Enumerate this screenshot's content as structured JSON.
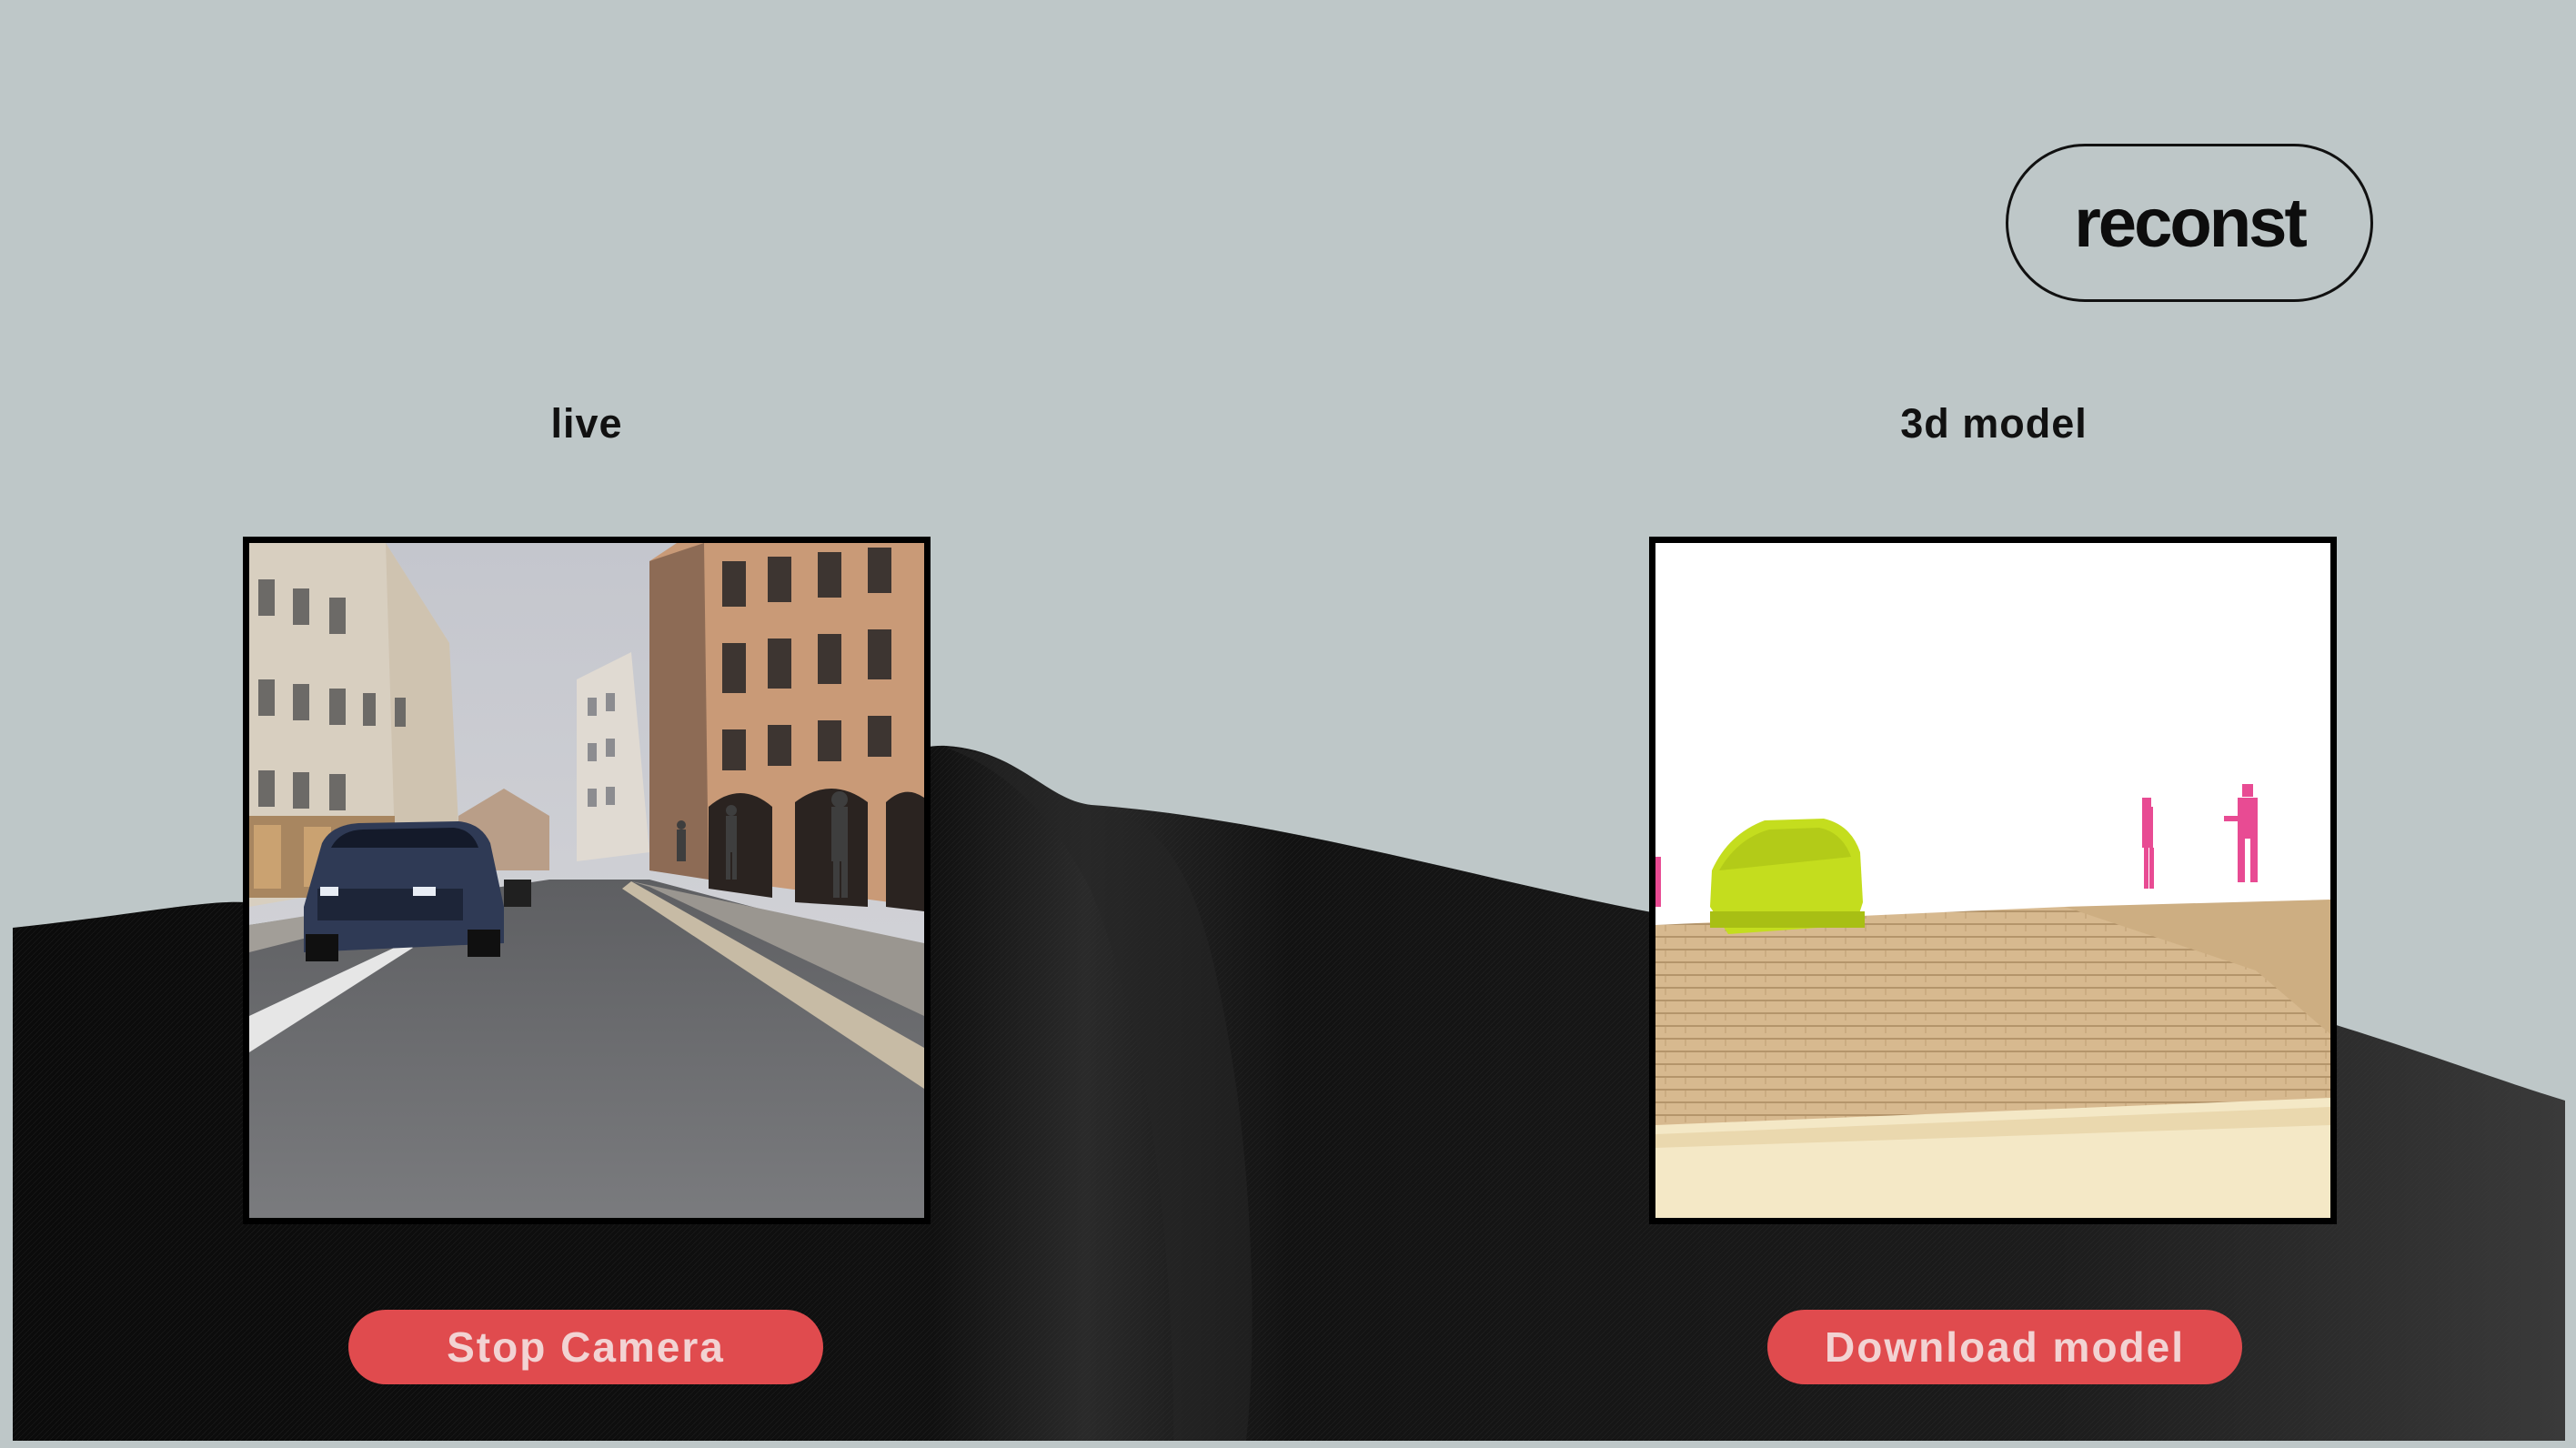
{
  "header": {
    "logo_label": "reconst"
  },
  "panels": {
    "live": {
      "title": "live",
      "button_label": "Stop Camera"
    },
    "model": {
      "title": "3d model",
      "button_label": "Download model"
    }
  },
  "colors": {
    "background": "#bec7c8",
    "surface_wave": "#0a0a0a",
    "button_fill": "#e04b4e",
    "button_text": "#f2d3d3",
    "voxel_car": "#c4dd1e",
    "voxel_people": "#e84b93",
    "voxel_ground": "#d7b98f"
  },
  "icons": {
    "logo": "reconst-pill-logo"
  }
}
